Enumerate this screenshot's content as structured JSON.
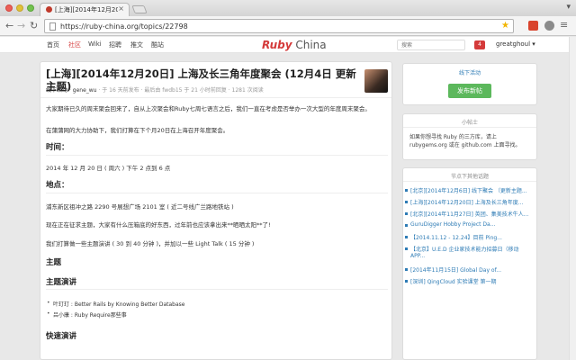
{
  "browser": {
    "tab_title": "[上海][2014年12月20日] 上海",
    "url": "https://ruby-china.org/topics/22798"
  },
  "site": {
    "nav": [
      "首页",
      "社区",
      "Wiki",
      "招聘",
      "酷站",
      "推文"
    ],
    "logo_ruby": "Ruby",
    "logo_china": " China",
    "search_placeholder": "搜索",
    "notification_count": "4",
    "username": "greatghoul ▾"
  },
  "topic": {
    "title": "[上海][2014年12月20日] 上海及长三角年度聚会 (12月4日 更新主题)",
    "meta_node": "线下活动",
    "meta_author": "gene_wu",
    "meta_rest": " · 于 16 天前发布 · 最后由 fwdb15 于 21 小时前回复 · 1281 次阅读",
    "paragraphs": {
      "p1": "大家期待已久的周末聚会回来了，自从上次聚会和Ruby七周七语言之后，我们一直在考虑是否举办一次大型的年度周末聚会。",
      "p2": "在蒲蒲网的大力协助下，我们打算在下个月20日在上海召开年度聚会。",
      "h_time": "时间：",
      "time": "2014 年 12 月 20 日 ( 周六 ) 下午 2 点到 6 点",
      "h_place": "地点：",
      "place": "浦东新区祖冲之路 2290 号展想广场 2101 室 ( 近二号线广兰路地铁站 )",
      "p3": "现在正在征求主题，大家有什么压箱底的好东西，过年前也应该拿出来**晒晒太阳**了!",
      "p4": "我们打算做一些主题演讲 ( 30 到 40 分钟 )，并加以一些 Light Talk ( 15 分钟 )",
      "h_theme": "主题",
      "h_talk": "主题演讲",
      "b1": "叶玎玎 : Better Rails by Knowing Better Database",
      "b2": "吕小康 : Ruby Require那些事",
      "h_quick": "快速演讲"
    }
  },
  "sidebar": {
    "events_link": "线下活动",
    "new_topic": "发布新帖",
    "tip_title": "小帖士",
    "tip_line1": "如果你想寻找 Ruby 的三方库，请上",
    "tip_line2": "rubygems.org 或在 github.com 上面寻找。",
    "hot_title": "节点下其他话题",
    "hot_items": [
      {
        "l1": "[北京][2014年12月6日] 线下聚会 （更新主题..."
      },
      {
        "l1": "[上海][2014年12月20日] 上海及长三角年度..."
      },
      {
        "l1": "[北京][2014年11月27日] 英团、集美技术牛人..."
      },
      {
        "l1": "GuruDigger Hobby Project Da..."
      },
      {
        "l1": "【2014.11.12 - 12.24】目前 Ping..."
      },
      {
        "l1": "【北京】U.E.D 企业家技术能力招募日（移动",
        "l2": "APP..."
      },
      {
        "l1": "[2014年11月15日] Global Day of..."
      },
      {
        "l1": "[深圳] QingCloud 实验课堂 第一期"
      }
    ]
  }
}
